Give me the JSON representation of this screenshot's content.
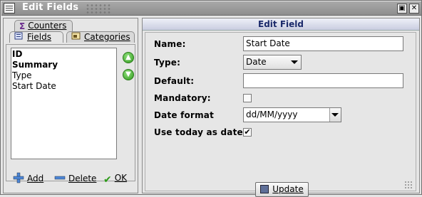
{
  "window": {
    "title": "Edit Fields",
    "buttons": [
      "▣",
      "✕"
    ]
  },
  "left": {
    "tabs": [
      {
        "icon": "sum-icon",
        "label": "Counters"
      },
      {
        "icon": "fields-icon",
        "label": "Fields"
      },
      {
        "icon": "categories-icon",
        "label": "Categories"
      }
    ],
    "fields": [
      "ID",
      "Summary",
      "Type",
      "Start Date"
    ],
    "bold_fields": [
      "ID",
      "Summary"
    ],
    "actions": {
      "add": "Add",
      "delete": "Delete",
      "ok": "OK"
    }
  },
  "right": {
    "header": "Edit Field",
    "labels": {
      "name": "Name:",
      "type": "Type:",
      "default": "Default:",
      "mandatory": "Mandatory:",
      "date_format": "Date format",
      "use_today": "Use today as date"
    },
    "values": {
      "name": "Start Date",
      "type": "Date",
      "default": "",
      "mandatory": false,
      "date_format": "dd/MM/yyyy",
      "use_today": true
    },
    "update_button": "Update"
  },
  "colors": {
    "title_bg": "#9a9a9a",
    "accent_header": "#1b2a6b",
    "green_button": "#3aa524"
  }
}
